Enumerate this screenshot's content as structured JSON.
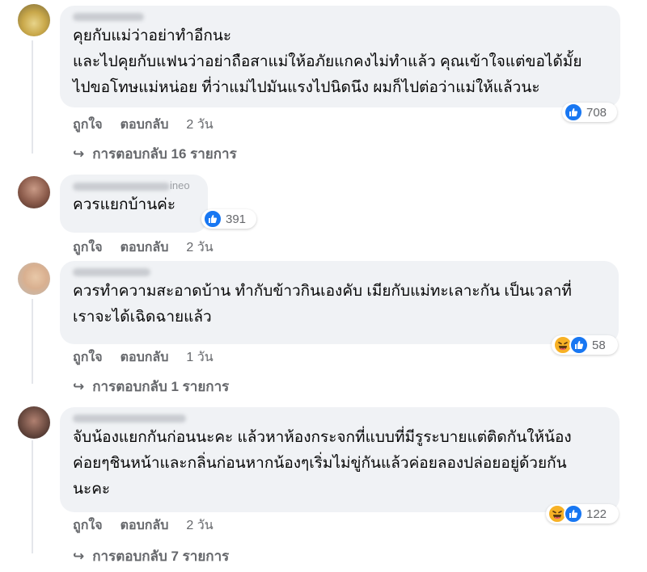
{
  "comments": [
    {
      "lines": [
        "คุยกับแม่ว่าอย่าทำอีกนะ",
        "และไปคุยกับแฟนว่าอย่าถือสาแม่ให้อภัยแกคงไม่ทำแล้ว คุณเข้าใจแต่ขอได้มั้ย",
        "ไปขอโทษแม่หน่อย ที่ว่าแม่ไปมันแรงไปนิดนึง ผมก็ไปต่อว่าแม่ให้แล้วนะ"
      ],
      "reaction_count": "708",
      "like": "ถูกใจ",
      "reply": "ตอบกลับ",
      "time": "2 วัน",
      "replies_text": "การตอบกลับ 16 รายการ"
    },
    {
      "author_visible": "ineo",
      "lines": [
        "ควรแยกบ้านค่ะ"
      ],
      "reaction_count": "391",
      "like": "ถูกใจ",
      "reply": "ตอบกลับ",
      "time": "2 วัน"
    },
    {
      "lines": [
        "ควรทำความสะอาดบ้าน ทำกับข้าวกินเองคับ เมียกับแม่ทะเลาะกัน เป็นเวลาที่",
        "เราจะได้เฉิดฉายแล้ว"
      ],
      "reaction_count": "58",
      "like": "ถูกใจ",
      "reply": "ตอบกลับ",
      "time": "1 วัน",
      "replies_text": "การตอบกลับ 1 รายการ"
    },
    {
      "lines": [
        "จับน้องแยกกันก่อนนะคะ แล้วหาห้องกระจกที่แบบที่มีรูระบายแต่ติดกันให้น้อง",
        "ค่อยๆชินหน้าและกลิ่นก่อนหากน้องๆเริ่มไม่ขู่กันแล้วค่อยลองปล่อยอยู่ด้วยกัน",
        "นะคะ"
      ],
      "reaction_count": "122",
      "like": "ถูกใจ",
      "reply": "ตอบกลับ",
      "time": "2 วัน",
      "replies_text": "การตอบกลับ 7 รายการ"
    }
  ],
  "colors": {
    "like_blue": "#1877f2",
    "haha_yellow": "#f7b125",
    "muted": "#65676b",
    "bubble": "#f0f2f5"
  }
}
